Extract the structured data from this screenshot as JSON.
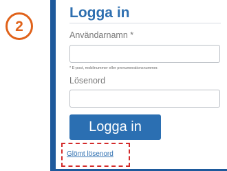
{
  "step_badge": {
    "number": "2"
  },
  "login_form": {
    "title": "Logga in",
    "username_label": "Användarnamn *",
    "username_value": "",
    "username_hint": "* E-post, mobilnummer eller prenumerationsnummer.",
    "password_label": "Lösenord",
    "password_value": "",
    "submit_label": "Logga in",
    "forgot_password_label": "Glömt lösenord"
  },
  "colors": {
    "accent": "#2b6fb2",
    "panel_border": "#1e5a9c",
    "badge": "#e0621a",
    "highlight": "#d32b2b"
  }
}
